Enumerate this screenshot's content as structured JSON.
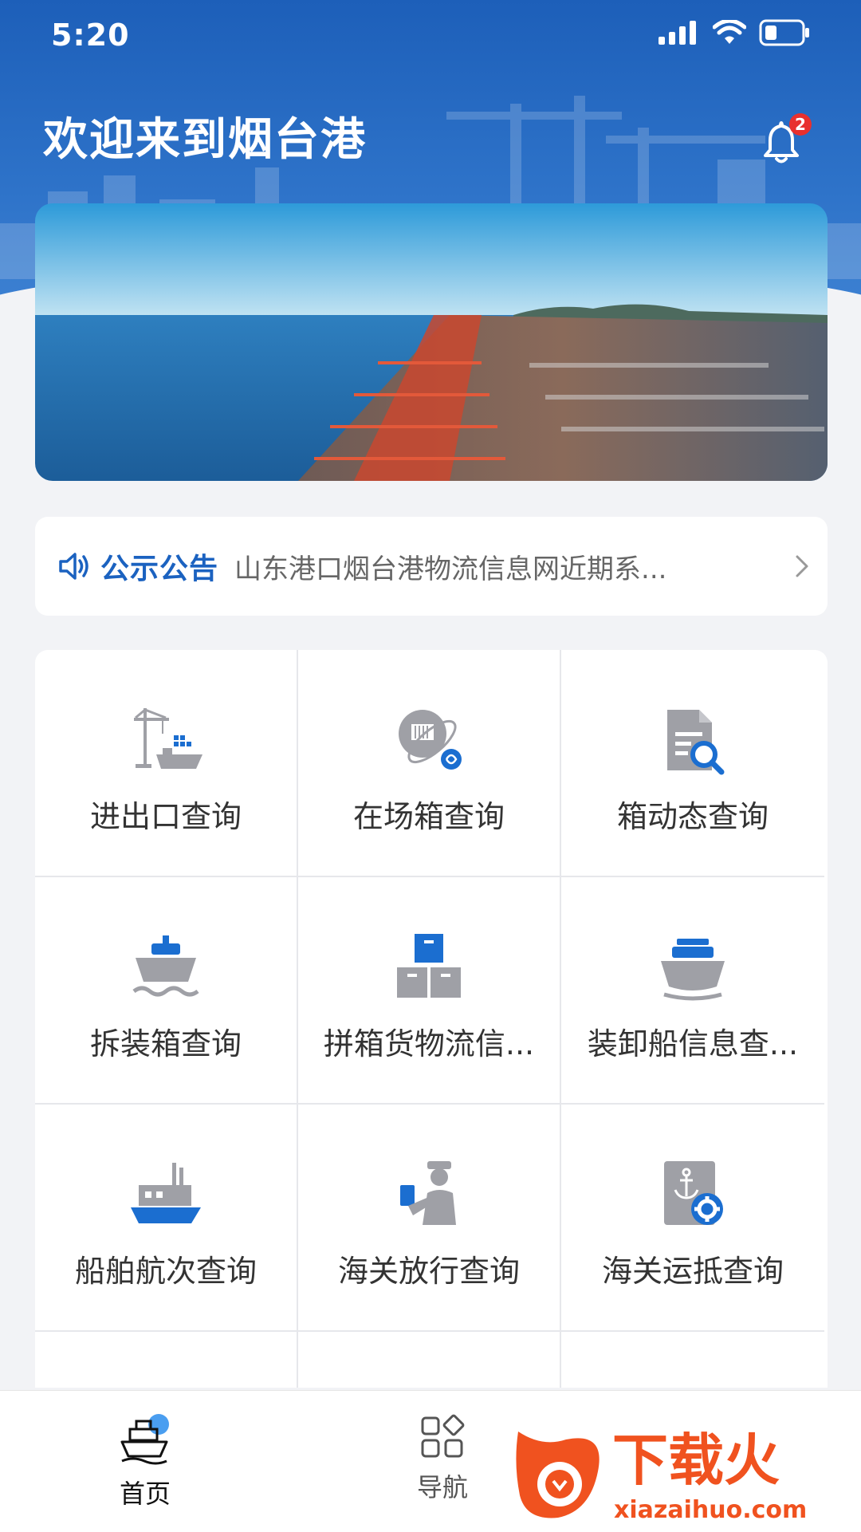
{
  "status_bar": {
    "time": "5:20"
  },
  "header": {
    "title": "欢迎来到烟台港",
    "notification_count": "2"
  },
  "notice": {
    "label": "公示公告",
    "text": "山东港口烟台港物流信息网近期系..."
  },
  "grid": {
    "items": [
      {
        "label": "进出口查询",
        "icon": "port-crane-ship-icon"
      },
      {
        "label": "在场箱查询",
        "icon": "container-yard-globe-icon"
      },
      {
        "label": "箱动态查询",
        "icon": "document-search-icon"
      },
      {
        "label": "拆装箱查询",
        "icon": "cargo-ship-icon"
      },
      {
        "label": "拼箱货物流信...",
        "icon": "stacked-boxes-icon"
      },
      {
        "label": "装卸船信息查...",
        "icon": "ship-loading-icon"
      },
      {
        "label": "船舶航次查询",
        "icon": "freighter-icon"
      },
      {
        "label": "海关放行查询",
        "icon": "customs-officer-icon"
      },
      {
        "label": "海关运抵查询",
        "icon": "anchor-gear-icon"
      }
    ]
  },
  "tabbar": {
    "home": "首页",
    "nav": "导航"
  },
  "watermark": {
    "brand": "下载火",
    "url": "xiazaihuo.com"
  },
  "colors": {
    "primary": "#1d5fb9",
    "icon_gray": "#9fa0a6",
    "icon_blue": "#1b6ed0",
    "badge": "#e8302e"
  }
}
